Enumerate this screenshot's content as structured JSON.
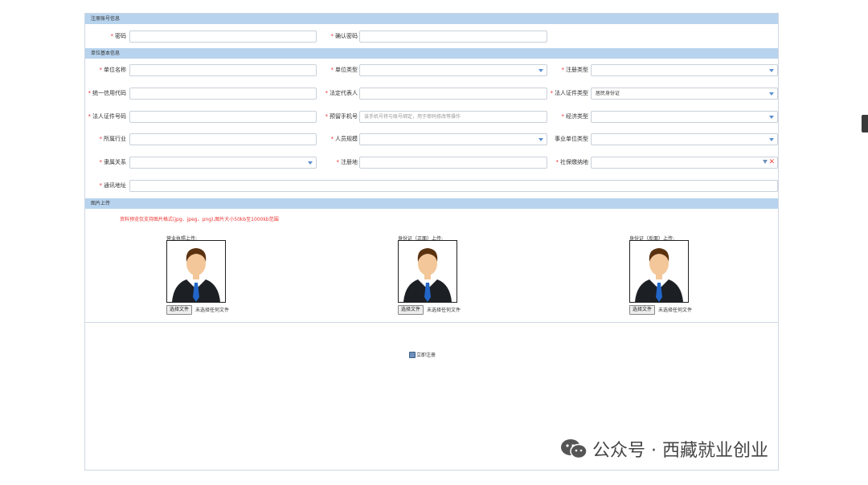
{
  "sections": {
    "account": "注册账号信息",
    "basic": "单位基本信息",
    "images": "图片上传"
  },
  "account": {
    "password_label": "密码",
    "confirm_password_label": "确认密码"
  },
  "basic": {
    "unit_name_label": "单位名称",
    "unit_type_label": "单位类型",
    "reg_type_label": "注册类型",
    "credit_code_label": "统一信用代码",
    "legal_rep_label": "法定代表人",
    "legal_id_type_label": "法人证件类型",
    "legal_id_type_value": "居民身份证",
    "legal_id_no_label": "法人证件号码",
    "phone_label": "预留手机号",
    "phone_placeholder": "该手机号将与账号绑定，用于密码修改等操作",
    "econ_type_label": "经济类型",
    "industry_label": "所属行业",
    "staff_scale_label": "人员规模",
    "public_unit_type_label": "事业单位类型",
    "affiliation_label": "隶属关系",
    "reg_place_label": "注册地",
    "social_insurance_label": "社保缴纳地",
    "address_label": "通讯地址"
  },
  "images": {
    "note": "资料预览仅支持图片格式(jpg、jpeg、png),图片大小50kb至1000kb范围",
    "uploads": [
      {
        "title": "营业执照上传:",
        "button": "选择文件",
        "status": "未选择任何文件"
      },
      {
        "title": "身份证（正面）上传:",
        "button": "选择文件",
        "status": "未选择任何文件"
      },
      {
        "title": "身份证（反面）上传:",
        "button": "选择文件",
        "status": "未选择任何文件"
      }
    ]
  },
  "submit_label": "立即注册",
  "watermark": "公众号 · 西藏就业创业",
  "required_mark": "*",
  "colors": {
    "header_bg": "#b7d3ee",
    "required": "#ee3333",
    "note": "#ee3333"
  }
}
